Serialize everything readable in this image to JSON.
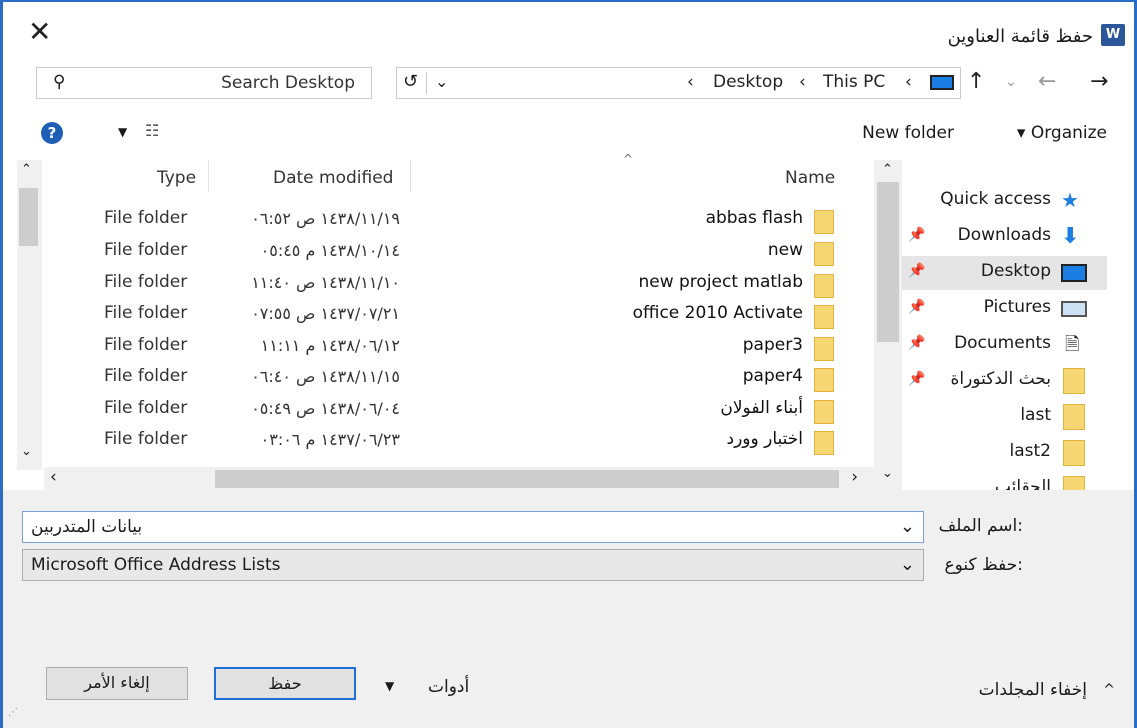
{
  "window": {
    "title": "حفظ قائمة العناوين",
    "app_icon_letter": "W"
  },
  "search": {
    "placeholder": "Search Desktop"
  },
  "breadcrumb": {
    "items": [
      "Desktop",
      "This PC"
    ],
    "separator": "‹"
  },
  "toolbar": {
    "new_folder": "New folder",
    "organize": "Organize",
    "help": "?"
  },
  "columns": {
    "name": "Name",
    "date": "Date modified",
    "type": "Type"
  },
  "files": [
    {
      "name": "abbas flash",
      "date": "١٤٣٨/١١/١٩ ص ٠٦:٥٢",
      "type": "File folder"
    },
    {
      "name": "new",
      "date": "١٤٣٨/١٠/١٤ م ٠٥:٤٥",
      "type": "File folder"
    },
    {
      "name": "new project matlab",
      "date": "١٤٣٨/١١/١٠ ص ١١:٤٠",
      "type": "File folder"
    },
    {
      "name": "office 2010 Activate",
      "date": "١٤٣٧/٠٧/٢١ ص ٠٧:٥٥",
      "type": "File folder"
    },
    {
      "name": "paper3",
      "date": "١٤٣٨/٠٦/١٢ م ١١:١١",
      "type": "File folder"
    },
    {
      "name": "paper4",
      "date": "١٤٣٨/١١/١٥ ص ٠٦:٤٠",
      "type": "File folder"
    },
    {
      "name": "أبناء الفولان",
      "date": "١٤٣٨/٠٦/٠٤ ص ٠٥:٤٩",
      "type": "File folder"
    },
    {
      "name": "اختبار وورد",
      "date": "١٤٣٧/٠٦/٢٣ م ٠٣:٠٦",
      "type": "File folder"
    }
  ],
  "nav_pane": {
    "items": [
      {
        "label": "Quick access",
        "pinned": false,
        "icon": "star-icon"
      },
      {
        "label": "Downloads",
        "pinned": true,
        "icon": "download-icon"
      },
      {
        "label": "Desktop",
        "pinned": true,
        "icon": "desktop-icon",
        "selected": true
      },
      {
        "label": "Pictures",
        "pinned": true,
        "icon": "pictures-icon"
      },
      {
        "label": "Documents",
        "pinned": true,
        "icon": "documents-icon"
      },
      {
        "label": "بحث الدكتوراة",
        "pinned": true,
        "icon": "folder-icon"
      },
      {
        "label": "last",
        "pinned": false,
        "icon": "folder-icon"
      },
      {
        "label": "last2",
        "pinned": false,
        "icon": "folder-icon"
      },
      {
        "label": "الحقائب",
        "pinned": false,
        "icon": "folder-icon"
      }
    ]
  },
  "form": {
    "filename_label": "اسم الملف:",
    "filename_value": "بيانات المتدربين",
    "savetype_label": "حفظ كنوع:",
    "savetype_value": "Microsoft Office Address Lists"
  },
  "footer": {
    "hide_folders": "إخفاء المجلدات",
    "tools": "أدوات",
    "save": "حفظ",
    "cancel": "إلغاء الأمر"
  }
}
